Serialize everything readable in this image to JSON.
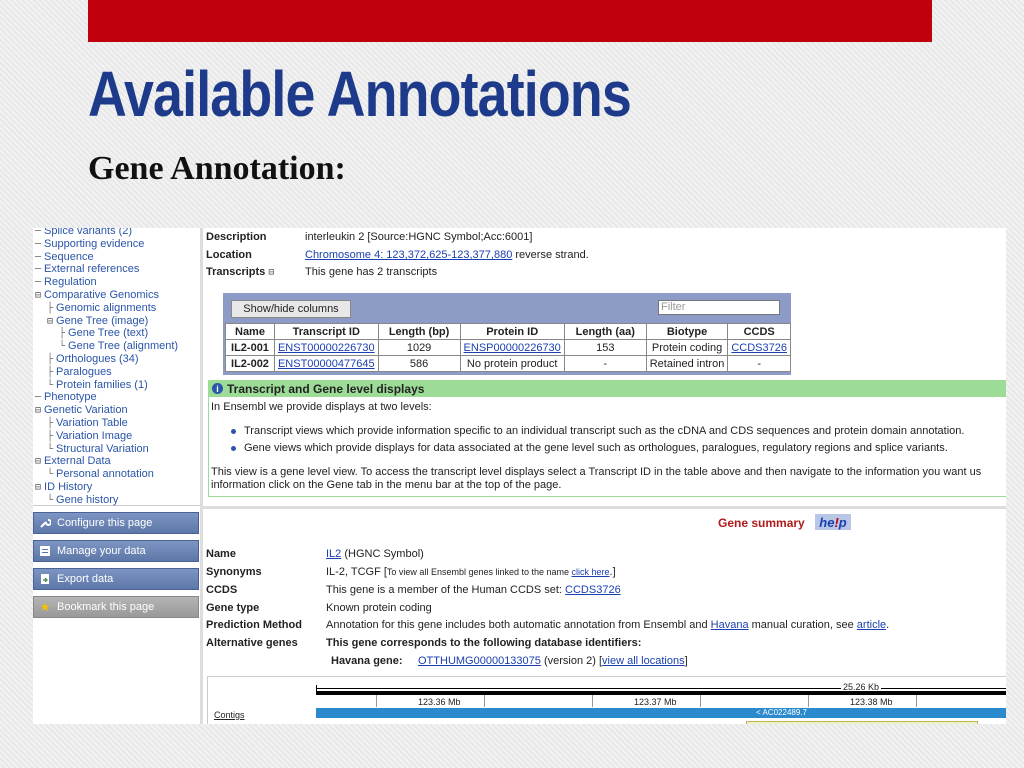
{
  "slide": {
    "title": "Available Annotations",
    "subtitle": "Gene Annotation:",
    "colors": {
      "top_bar": "#c0000c",
      "title": "#1e3b8b"
    }
  },
  "tree": {
    "items": [
      {
        "label": "Splice variants (2)",
        "prefix": "─"
      },
      {
        "label": "Supporting evidence",
        "prefix": "─"
      },
      {
        "label": "Sequence",
        "prefix": "─"
      },
      {
        "label": "External references",
        "prefix": "─"
      },
      {
        "label": "Regulation",
        "prefix": "─"
      },
      {
        "label": "Comparative Genomics",
        "prefix": "⊟"
      },
      {
        "label": "Genomic alignments",
        "prefix": "├"
      },
      {
        "label": "Gene Tree (image)",
        "prefix": "⊟"
      },
      {
        "label": "Gene Tree (text)",
        "prefix": "├"
      },
      {
        "label": "Gene Tree (alignment)",
        "prefix": "└"
      },
      {
        "label": "Orthologues (34)",
        "prefix": "├"
      },
      {
        "label": "Paralogues",
        "prefix": "├"
      },
      {
        "label": "Protein families (1)",
        "prefix": "└"
      },
      {
        "label": "Phenotype",
        "prefix": "─"
      },
      {
        "label": "Genetic Variation",
        "prefix": "⊟"
      },
      {
        "label": "Variation Table",
        "prefix": "├"
      },
      {
        "label": "Variation Image",
        "prefix": "├"
      },
      {
        "label": "Structural Variation",
        "prefix": "└"
      },
      {
        "label": "External Data",
        "prefix": "⊟"
      },
      {
        "label": "Personal annotation",
        "prefix": "└"
      },
      {
        "label": "ID History",
        "prefix": "⊟"
      },
      {
        "label": "Gene history",
        "prefix": "└"
      }
    ]
  },
  "side_buttons": {
    "configure": "Configure this page",
    "manage": "Manage your data",
    "export": "Export data",
    "bookmark": "Bookmark this page"
  },
  "gene_header": {
    "description_label": "Description",
    "description_value": "interleukin 2 [Source:HGNC Symbol;Acc:6001]",
    "location_label": "Location",
    "location_link": "Chromosome 4: 123,372,625-123,377,880",
    "location_suffix": " reverse strand.",
    "transcripts_label": "Transcripts",
    "transcripts_value": "This gene has 2 transcripts"
  },
  "transcript_table": {
    "show_hide": "Show/hide columns",
    "filter_placeholder": "Filter",
    "headers": [
      "Name",
      "Transcript ID",
      "Length (bp)",
      "Protein ID",
      "Length (aa)",
      "Biotype",
      "CCDS"
    ],
    "rows": [
      {
        "name": "IL2-001",
        "transcript_id": "ENST00000226730",
        "length_bp": "1029",
        "protein_id": "ENSP00000226730",
        "length_aa": "153",
        "biotype": "Protein coding",
        "ccds": "CCDS3726"
      },
      {
        "name": "IL2-002",
        "transcript_id": "ENST00000477645",
        "length_bp": "586",
        "protein_id": "No protein product",
        "length_aa": "-",
        "biotype": "Retained intron",
        "ccds": "-"
      }
    ]
  },
  "levels_panel": {
    "heading": "Transcript and Gene level displays",
    "intro": "In Ensembl we provide displays at two levels:",
    "bullet1": "Transcript views which provide information specific to an individual transcript such as the cDNA and CDS sequences and protein domain annotation.",
    "bullet2": "Gene views which provide displays for data associated at the gene level such as orthologues, paralogues, regulatory regions and splice variants.",
    "para_line1": "This view is a gene level view. To access the transcript level displays select a Transcript ID in the table above and then navigate to the information you want us",
    "para_line2": "information click on the Gene tab in the menu bar at the top of the page."
  },
  "gene_summary": {
    "title": "Gene summary",
    "help_pre": "he",
    "help_ex": "!",
    "help_post": "p",
    "name_label": "Name",
    "name_link": "IL2",
    "name_suffix": " (HGNC Symbol)",
    "synonyms_label": "Synonyms",
    "synonyms_value": "IL-2, TCGF [",
    "synonyms_note": "To view all Ensembl genes linked to the name ",
    "synonyms_link": "click here",
    "synonyms_end": ".]",
    "ccds_label": "CCDS",
    "ccds_value": "This gene is a member of the Human CCDS set: ",
    "ccds_link": "CCDS3726",
    "genetype_label": "Gene type",
    "genetype_value": "Known protein coding",
    "prediction_label": "Prediction Method",
    "prediction_value": "Annotation for this gene includes both automatic annotation from Ensembl and ",
    "prediction_link1": "Havana",
    "prediction_mid": " manual curation, see ",
    "prediction_link2": "article",
    "prediction_end": ".",
    "alt_label": "Alternative genes",
    "alt_value": "This gene corresponds to the following database identifiers:",
    "havana_label": "Havana gene:",
    "havana_link": "OTTHUMG00000133075",
    "havana_mid": " (version 2) [",
    "havana_link2": "view all locations",
    "havana_end": "]"
  },
  "browser": {
    "contigs": "Contigs",
    "kb": "25.26 Kb",
    "mb1": "123.36 Mb",
    "mb2": "123.37 Mb",
    "mb3": "123.38 Mb",
    "contig_name": "< AC022489.7"
  }
}
